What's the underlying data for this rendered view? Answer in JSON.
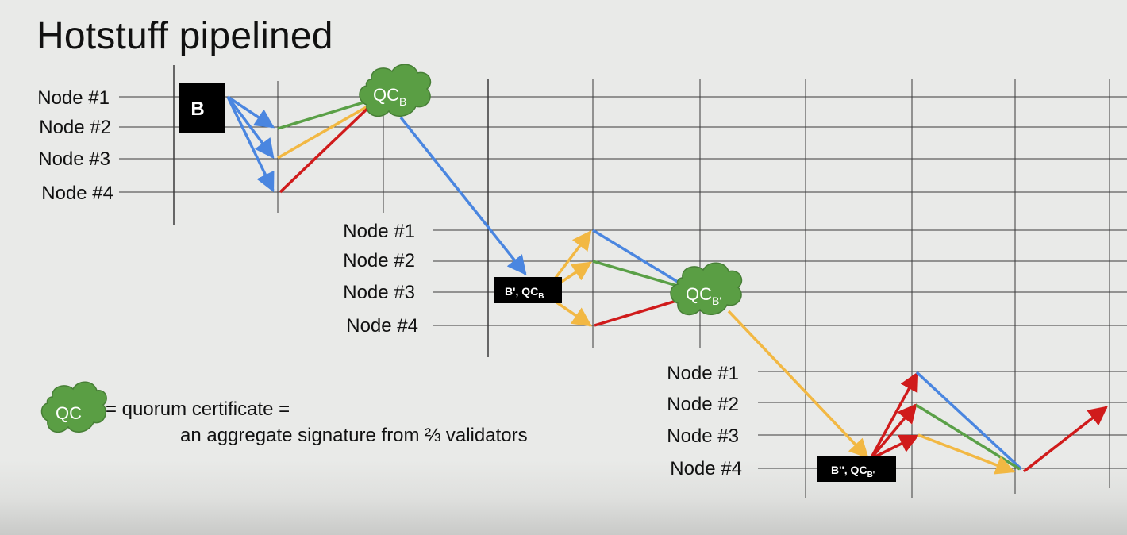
{
  "title": "Hotstuff pipelined",
  "rows": {
    "one": {
      "labels": [
        "Node #1",
        "Node #2",
        "Node #3",
        "Node #4"
      ],
      "block": "B",
      "qc": {
        "main": "QC",
        "sub": "B"
      }
    },
    "two": {
      "labels": [
        "Node #1",
        "Node #2",
        "Node #3",
        "Node #4"
      ],
      "block": {
        "main": "B', QC",
        "sub": "B"
      },
      "qc": {
        "main": "QC",
        "sub": "B'"
      }
    },
    "three": {
      "labels": [
        "Node #1",
        "Node #2",
        "Node #3",
        "Node #4"
      ],
      "block": {
        "main": "B'', QC",
        "sub": "B'"
      }
    }
  },
  "legend": {
    "symbol": "QC",
    "line1": "= quorum certificate =",
    "line2": "an aggregate signature from ⅔ validators"
  },
  "colors": {
    "blue": "#4a86e0",
    "green": "#5aa047",
    "yellow": "#f2b843",
    "red": "#d01b1b",
    "cloud": "#5a9e44",
    "grid": "#3a3a3a",
    "box": "#000000"
  }
}
